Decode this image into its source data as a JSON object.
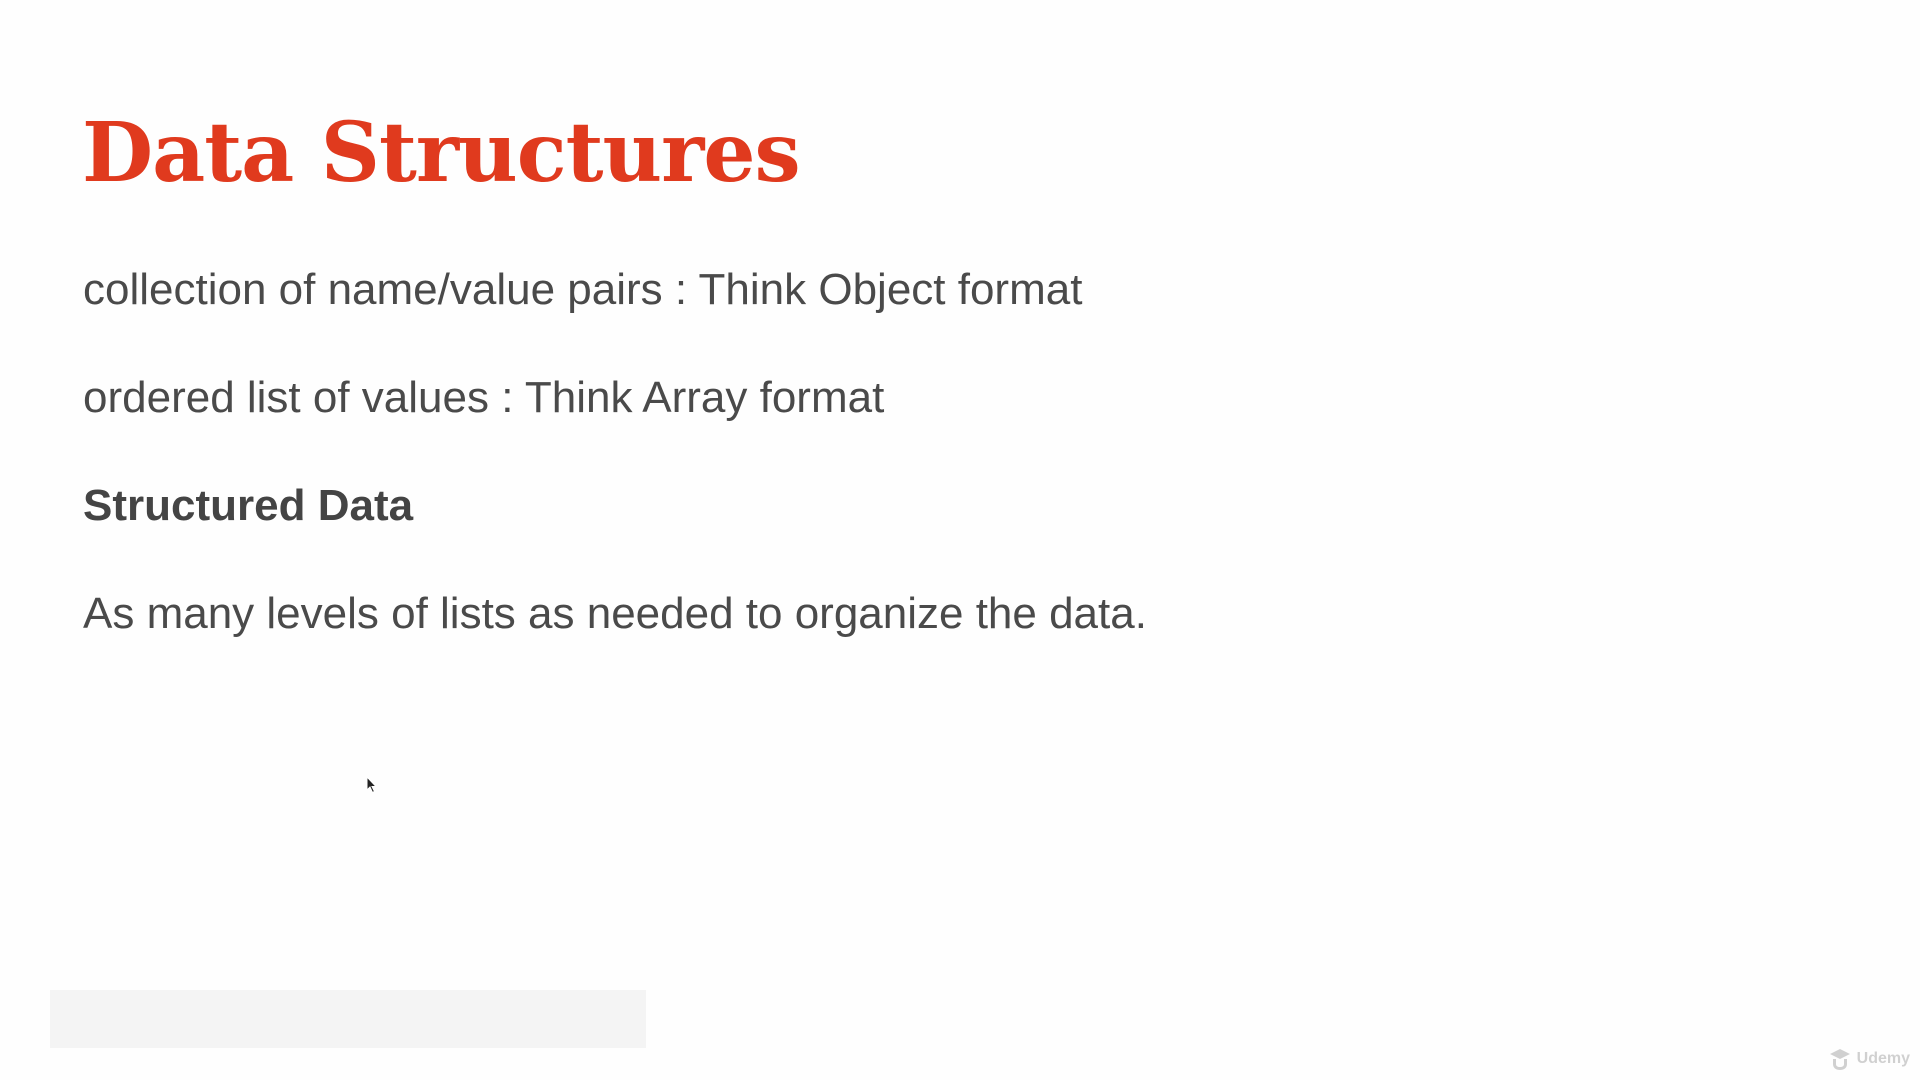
{
  "slide": {
    "title": "Data Structures",
    "lines": [
      "collection of name/value pairs : Think Object format",
      "ordered list of values : Think Array format",
      "Structured Data",
      "As many levels of lists as needed to organize the data."
    ]
  },
  "watermark": {
    "text": "Udemy",
    "icon": "udemy-logo-icon"
  },
  "cursor": {
    "icon": "mouse-pointer-icon"
  },
  "colors": {
    "title": "#e03a1e",
    "body_text": "#4a4a4a",
    "background": "#fefefe"
  }
}
